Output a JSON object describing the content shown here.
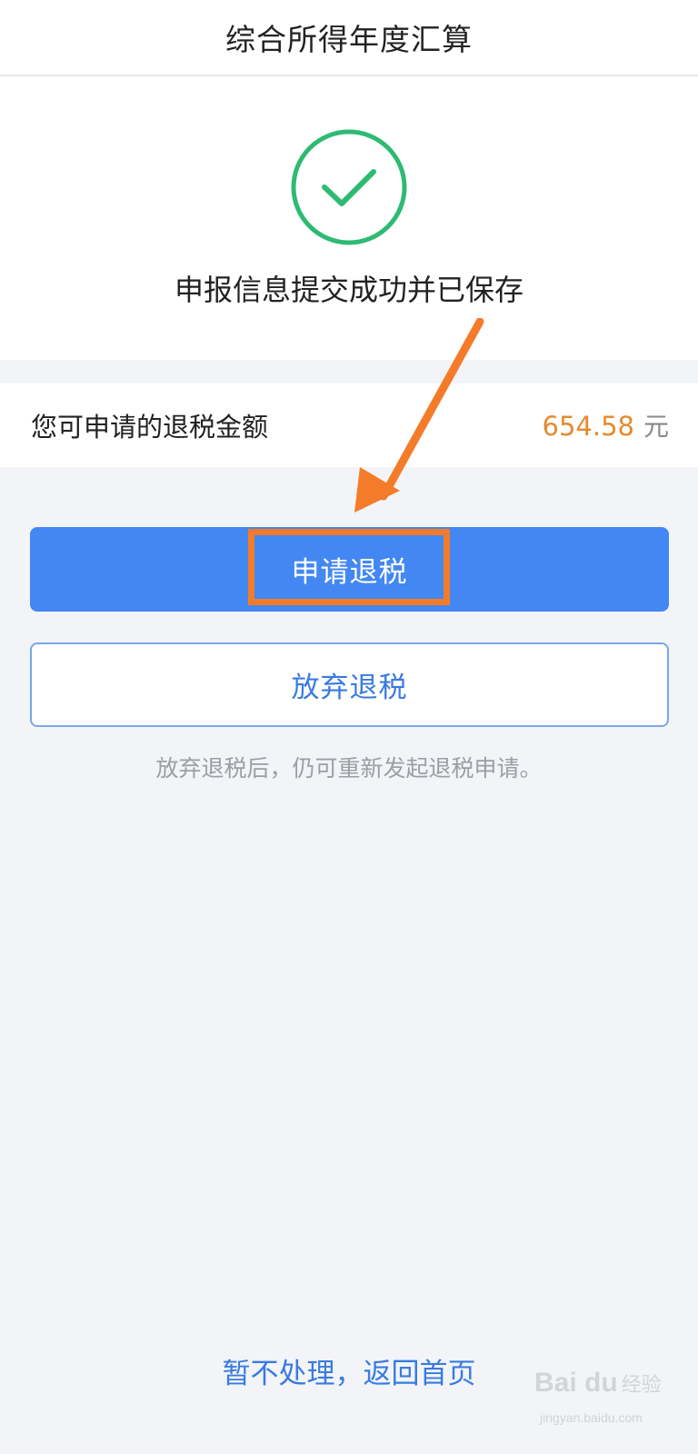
{
  "header": {
    "title": "综合所得年度汇算"
  },
  "result": {
    "message": "申报信息提交成功并已保存",
    "icon": "check-circle-icon",
    "icon_color": "#2fba73"
  },
  "refund": {
    "label": "您可申请的退税金额",
    "amount": "654.58",
    "unit": "元",
    "amount_color": "#e58a2e"
  },
  "actions": {
    "apply_label": "申请退税",
    "giveup_label": "放弃退税",
    "hint": "放弃退税后，仍可重新发起退税申请。"
  },
  "footer": {
    "link": "暂不处理，返回首页"
  },
  "watermark": {
    "logo": "Bai du",
    "sub": "经验",
    "url": "jingyan.baidu.com"
  },
  "colors": {
    "primary": "#4387f3",
    "highlight": "#f47b2a",
    "background": "#f2f4f8"
  }
}
